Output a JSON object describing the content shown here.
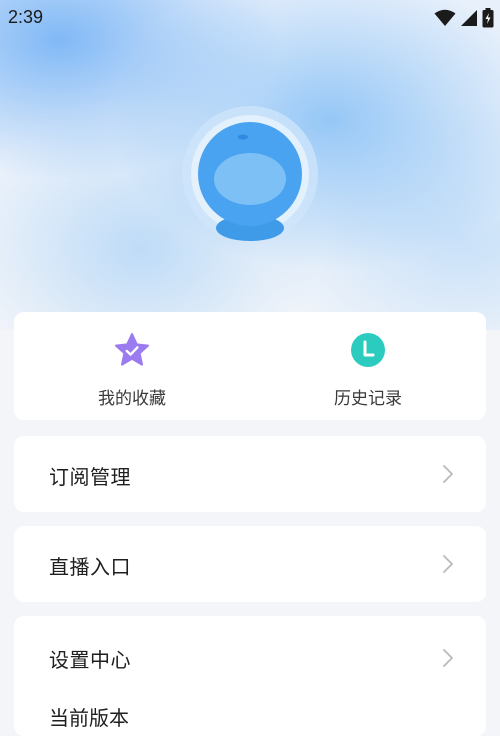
{
  "status_bar": {
    "time": "2:39",
    "icons": [
      "wifi-icon",
      "signal-icon",
      "battery-icon"
    ]
  },
  "profile": {
    "avatar_icon": "robot-avatar-icon",
    "avatar_color": "#4aa3f0"
  },
  "quick_actions": [
    {
      "label": "我的收藏",
      "icon": "favorite-star-icon",
      "color": "#9b7bf0"
    },
    {
      "label": "历史记录",
      "icon": "history-clock-icon",
      "color": "#2ccbc0"
    }
  ],
  "menu": {
    "subscription": {
      "label": "订阅管理"
    },
    "live": {
      "label": "直播入口"
    },
    "settings": {
      "label": "设置中心"
    },
    "version": {
      "label": "当前版本",
      "value": ""
    }
  }
}
